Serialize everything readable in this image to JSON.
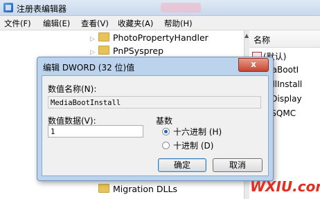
{
  "window": {
    "title": "注册表编辑器",
    "menu": [
      "文件(F)",
      "编辑(E)",
      "查看(V)",
      "收藏夹(A)",
      "帮助(H)"
    ]
  },
  "tree": {
    "items": [
      "PhotoPropertyHandler",
      "PnPSysprep",
      "Migration DLLs"
    ]
  },
  "values_panel": {
    "header": "名称",
    "rows": [
      "(默认)",
      "MediaBootI",
      "InstallInstall",
      "etupDisplay",
      "etupSQMC"
    ]
  },
  "dialog": {
    "title": "编辑 DWORD (32 位)值",
    "close": "x",
    "name_label": "数值名称(N):",
    "name_value": "MediaBootInstall",
    "data_label": "数值数据(V):",
    "data_value": "1",
    "base_label": "基数",
    "base_hex": "十六进制 (H)",
    "base_dec": "十进制 (D)",
    "selected_base": "hex",
    "ok": "确定",
    "cancel": "取消"
  },
  "watermark": "WXIU.com"
}
